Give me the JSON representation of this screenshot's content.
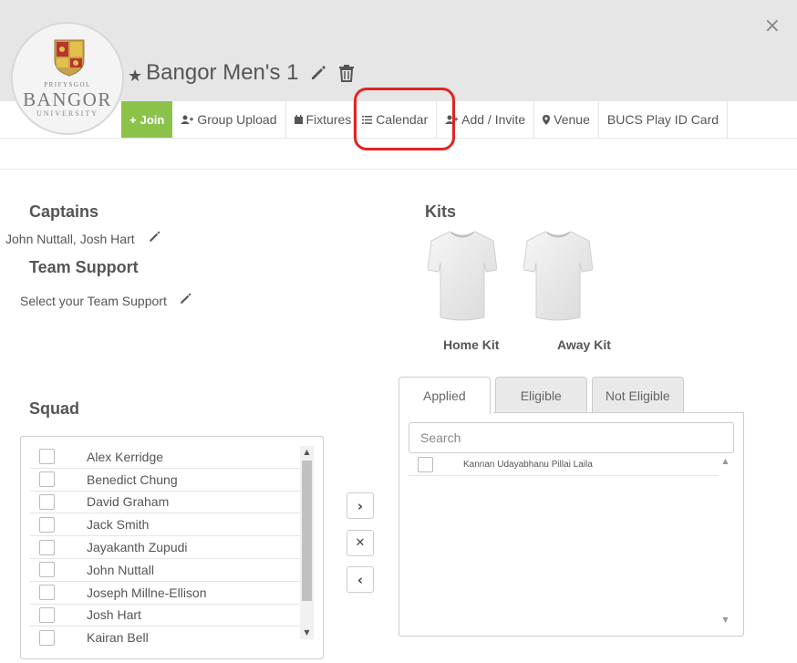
{
  "header": {
    "close_label": "×",
    "logo": {
      "line1": "PRIFYSGOL",
      "line2": "BANGOR",
      "line3": "UNIVERSITY"
    },
    "team_name": "Bangor Men's 1"
  },
  "nav": {
    "join": "Join",
    "group_upload": "Group Upload",
    "fixtures": "Fixtures",
    "calendar": "Calendar",
    "add_invite": "Add / Invite",
    "venue": "Venue",
    "bucs": "BUCS Play ID Card"
  },
  "captains": {
    "heading": "Captains",
    "names": "John Nuttall, Josh Hart"
  },
  "team_support": {
    "heading": "Team Support",
    "text": "Select your Team Support"
  },
  "kits": {
    "heading": "Kits",
    "home": "Home Kit",
    "away": "Away Kit"
  },
  "squad": {
    "heading": "Squad",
    "members": [
      "Alex Kerridge",
      "Benedict Chung",
      "David Graham",
      "Jack Smith",
      "Jayakanth Zupudi",
      "John Nuttall",
      "Joseph Millne-Ellison",
      "Josh Hart",
      "Kairan Bell"
    ]
  },
  "transfer_buttons": {
    "right": "›",
    "remove": "✕",
    "left": "‹"
  },
  "tabs": {
    "applied": "Applied",
    "eligible": "Eligible",
    "not_eligible": "Not Eligible"
  },
  "applicants": {
    "search_placeholder": "Search",
    "list": [
      "Kannan Udayabhanu Pillai Laila"
    ]
  },
  "colors": {
    "join_green": "#8bc34a",
    "highlight_red": "#e02424",
    "header_gray": "#e6e6e6"
  }
}
